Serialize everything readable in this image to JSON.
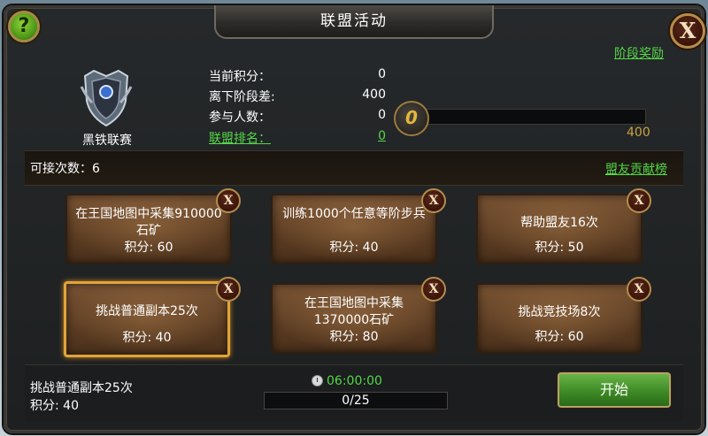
{
  "title": "联盟活动",
  "help_glyph": "?",
  "close_glyph": "X",
  "links": {
    "stage_reward": "阶段奖励",
    "contribution_rank": "盟友贡献榜"
  },
  "league": {
    "name": "黑铁联赛",
    "icon": "shield-badge-icon"
  },
  "stats": {
    "current_score_label": "当前积分：",
    "current_score": "0",
    "next_stage_label": "离下阶段差:",
    "next_stage": "400",
    "participants_label": "参与人数：",
    "participants": "0",
    "alliance_rank_label": "联盟排名：",
    "alliance_rank": "0"
  },
  "progress": {
    "medal_value": "0",
    "max": "400",
    "fraction": 0
  },
  "attempts": "可接次数：6",
  "task_remove_glyph": "X",
  "tasks": [
    {
      "name": "在王国地图中采集910000石矿",
      "score": "积分: 60"
    },
    {
      "name": "训练1000个任意等阶步兵",
      "score": "积分: 40"
    },
    {
      "name": "帮助盟友16次",
      "score": "积分: 50"
    },
    {
      "name": "挑战普通副本25次",
      "score": "积分: 40"
    },
    {
      "name": "在王国地图中采集1370000石矿",
      "score": "积分: 80"
    },
    {
      "name": "挑战竞技场8次",
      "score": "积分: 60"
    }
  ],
  "selected": {
    "name": "挑战普通副本25次",
    "score": "积分: 40"
  },
  "timer": "06:00:00",
  "count": "0/25",
  "start_label": "开始",
  "colors": {
    "accent_green": "#54d848",
    "gold": "#c9a443",
    "selected_border": "#e0a43b"
  }
}
